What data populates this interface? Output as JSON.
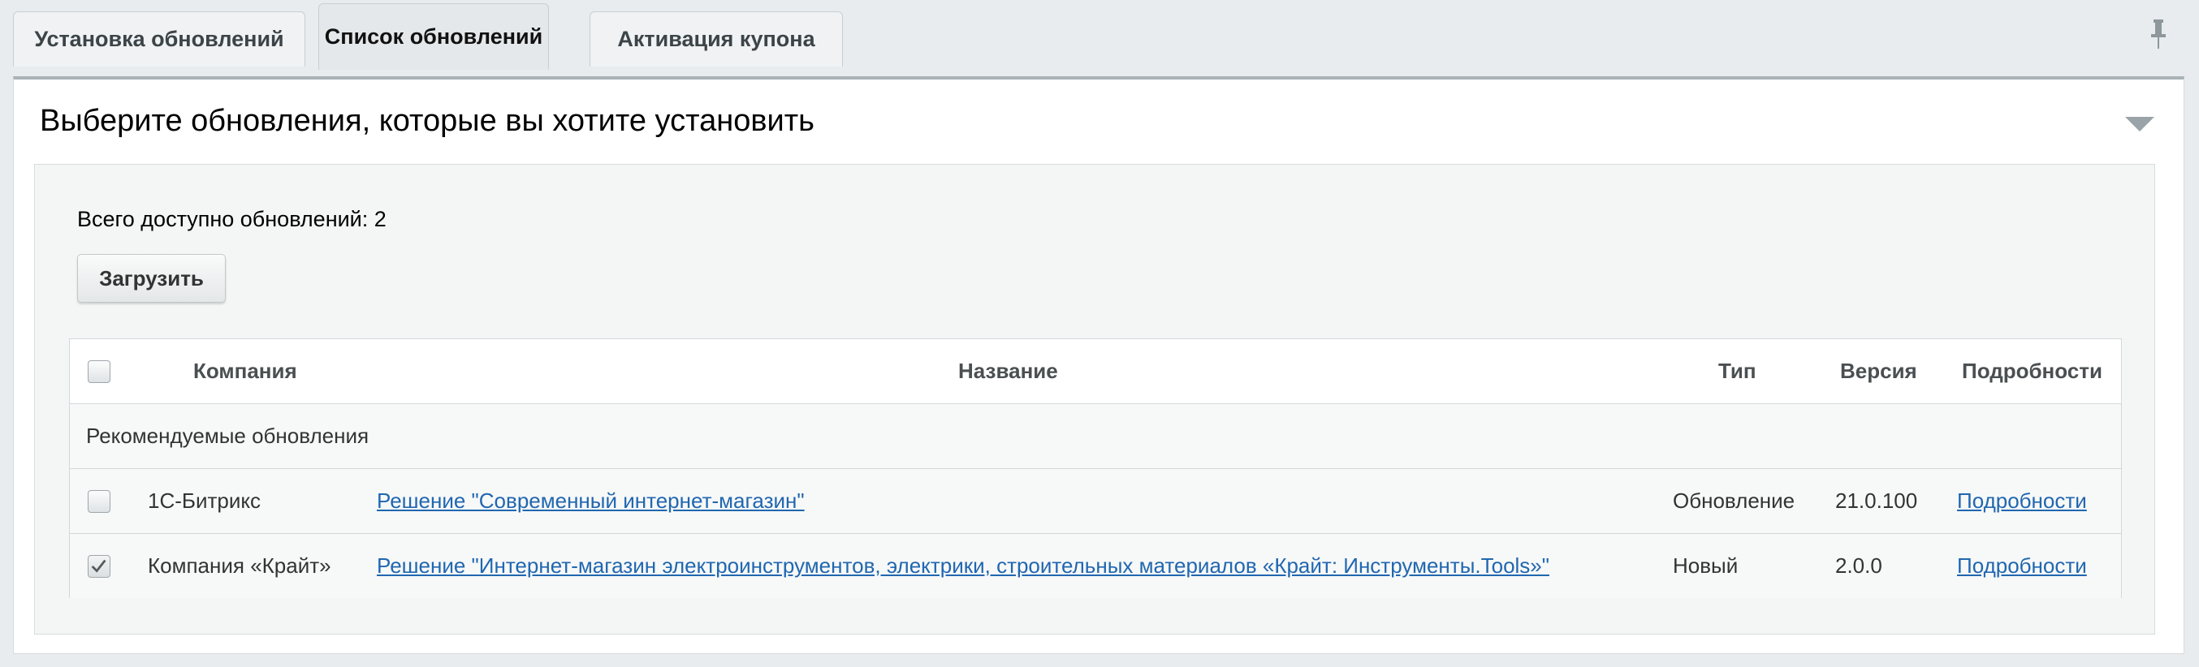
{
  "tabs": [
    {
      "label": "Установка обновлений"
    },
    {
      "label": "Список обновлений"
    },
    {
      "label": "Активация купона"
    }
  ],
  "panel": {
    "title": "Выберите обновления, которые вы хотите установить",
    "count_text": "Всего доступно обновлений: 2",
    "load_button": "Загрузить"
  },
  "table": {
    "headers": {
      "company": "Компания",
      "name": "Название",
      "type": "Тип",
      "version": "Версия",
      "details": "Подробности"
    },
    "group_label": "Рекомендуемые обновления",
    "rows": [
      {
        "checked": false,
        "company": "1С-Битрикс",
        "name": "Решение \"Современный интернет-магазин\"",
        "type": "Обновление",
        "version": "21.0.100",
        "details": "Подробности"
      },
      {
        "checked": true,
        "company": "Компания «Крайт»",
        "name": "Решение \"Интернет-магазин электроинструментов, электрики, строительных материалов «Крайт: Инструменты.Tools»\"",
        "type": "Новый",
        "version": "2.0.0",
        "details": "Подробности"
      }
    ]
  },
  "colors": {
    "link": "#2067b0",
    "background": "#e8ecee",
    "panel_border": "#a9b2b7"
  },
  "icons": {
    "pin": "pin-icon",
    "collapse": "triangle-down-icon",
    "check": "checkmark-icon"
  }
}
